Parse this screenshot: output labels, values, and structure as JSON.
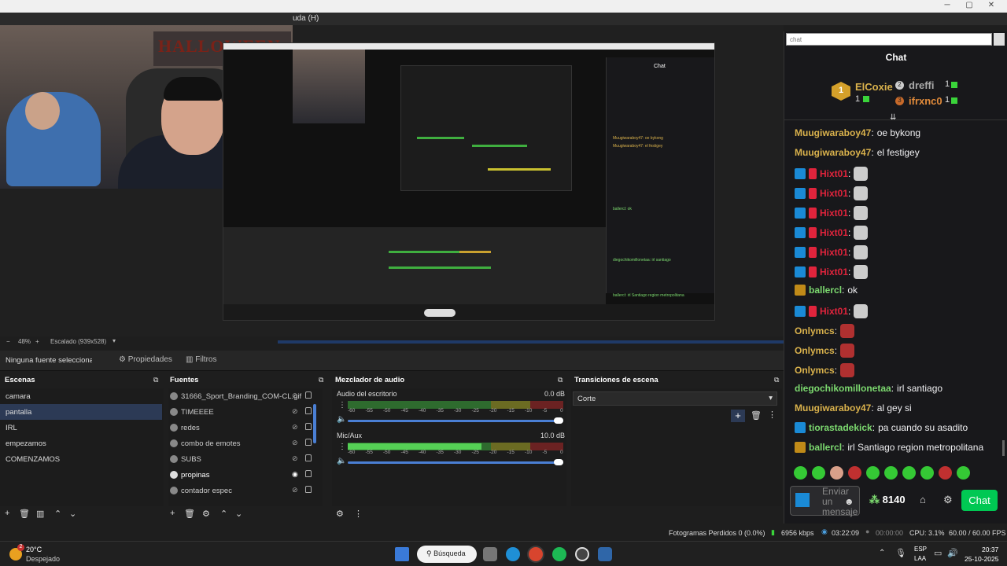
{
  "menubar": {
    "partial_text": "uda (H)"
  },
  "preview": {
    "banner_text": "HALLOWEEN"
  },
  "scalebar": {
    "zoom": "48%",
    "scaling": "Escalado (939x528)"
  },
  "propbar": {
    "no_source": "Ninguna fuente seleccionad",
    "properties": "Propiedades",
    "filters": "Filtros"
  },
  "scenes": {
    "title": "Escenas",
    "items": [
      "camara",
      "pantalla",
      "IRL",
      "empezamos",
      "COMENZAMOS"
    ],
    "selected": "pantalla"
  },
  "sources": {
    "title": "Fuentes",
    "items": [
      "31666_Sport_Branding_COM-CL.gif",
      "TIMEEEE",
      "redes",
      "combo de emotes",
      "SUBS",
      "propinas",
      "contador espec"
    ]
  },
  "mixer": {
    "title": "Mezclador de audio",
    "channels": [
      {
        "name": "Audio del escritorio",
        "db": "0.0 dB",
        "level": 0.0
      },
      {
        "name": "Mic/Aux",
        "db": "10.0 dB",
        "level": 0.62
      }
    ],
    "ticks": [
      "-60",
      "-55",
      "-50",
      "-45",
      "-40",
      "-35",
      "-30",
      "-25",
      "-20",
      "-15",
      "-10",
      "-5",
      "0"
    ]
  },
  "transitions": {
    "title": "Transiciones de escena",
    "selected": "Corte"
  },
  "chat": {
    "address": "chat",
    "title": "Chat",
    "leaderboard": [
      {
        "rank": "1",
        "name": "ElCoxie",
        "count": "1"
      },
      {
        "rank": "2",
        "name": "dreffi",
        "count": "1"
      },
      {
        "rank": "3",
        "name": "ifrxnc0",
        "count": "1"
      }
    ],
    "messages": [
      {
        "user": "Muugiwaraboy47",
        "text": "oe bykong",
        "color": "y",
        "badge": "none",
        "emote": false
      },
      {
        "user": "Muugiwaraboy47",
        "text": "el festigey",
        "color": "y",
        "badge": "none",
        "emote": false
      },
      {
        "user": "Hixt01",
        "text": "",
        "color": "r",
        "badge": "blue",
        "emote": true
      },
      {
        "user": "Hixt01",
        "text": "",
        "color": "r",
        "badge": "blue",
        "emote": true
      },
      {
        "user": "Hixt01",
        "text": "",
        "color": "r",
        "badge": "blue",
        "emote": true
      },
      {
        "user": "Hixt01",
        "text": "",
        "color": "r",
        "badge": "blue",
        "emote": true
      },
      {
        "user": "Hixt01",
        "text": "",
        "color": "r",
        "badge": "blue",
        "emote": true
      },
      {
        "user": "Hixt01",
        "text": "",
        "color": "r",
        "badge": "blue",
        "emote": true
      },
      {
        "user": "ballercl",
        "text": "ok",
        "color": "g",
        "badge": "crown",
        "emote": false
      },
      {
        "user": "Hixt01",
        "text": "",
        "color": "r",
        "badge": "blue",
        "emote": true
      },
      {
        "user": "Onlymcs",
        "text": "",
        "color": "y",
        "badge": "none",
        "emote": true
      },
      {
        "user": "Onlymcs",
        "text": "",
        "color": "y",
        "badge": "none",
        "emote": true
      },
      {
        "user": "Onlymcs",
        "text": "",
        "color": "y",
        "badge": "none",
        "emote": true
      },
      {
        "user": "diegochikomillonetaa",
        "text": "irl santiago",
        "color": "g",
        "badge": "none",
        "emote": false
      },
      {
        "user": "Muugiwaraboy47",
        "text": "al gey si",
        "color": "y",
        "badge": "none",
        "emote": false
      },
      {
        "user": "tiorastadekick",
        "text": "pa cuando su asadito",
        "color": "g",
        "badge": "blue",
        "emote": false
      },
      {
        "user": "ballercl",
        "text": "irl Santiago region metropolitana",
        "color": "g",
        "badge": "crown",
        "emote": false
      }
    ],
    "input_placeholder": "Enviar un mensaje",
    "points": "8140",
    "chat_button": "Chat"
  },
  "status": {
    "dropped": "Fotogramas Perdidos 0 (0.0%)",
    "kbps": "6956 kbps",
    "live_time": "03:22:09",
    "rec_time": "00:00:00",
    "cpu": "CPU: 3.1%",
    "fps": "60.00 / 60.00 FPS"
  },
  "taskbar": {
    "weather_temp": "20°C",
    "weather_desc": "Despejado",
    "weather_badge": "2",
    "search": "Búsqueda",
    "lang1": "ESP",
    "lang2": "LAA",
    "time": "20:37",
    "date": "25-10-2025"
  },
  "colors": {
    "accent": "#1a8ad6",
    "twitch_green": "#00c853",
    "chat_bg": "#18181b"
  }
}
